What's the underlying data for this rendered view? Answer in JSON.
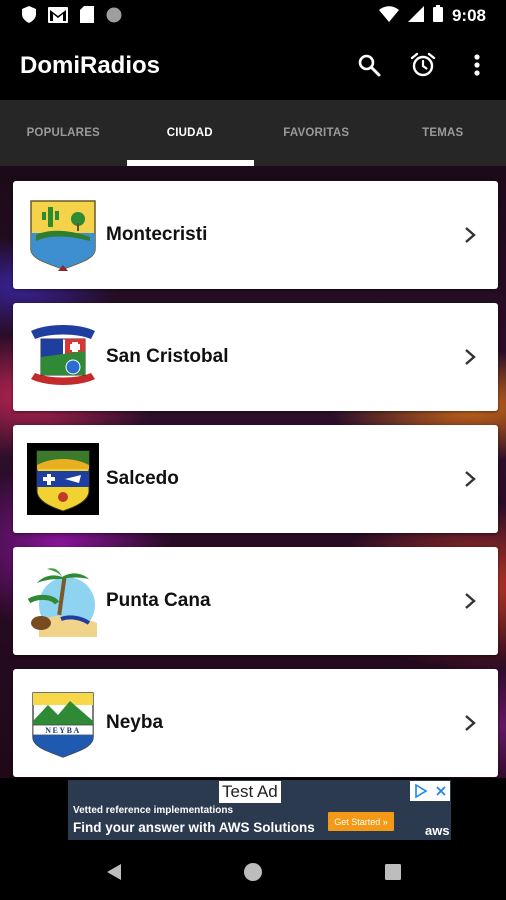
{
  "status_bar": {
    "time": "9:08",
    "left_icons": [
      "shield-icon",
      "gmail-icon",
      "sd-card-icon",
      "circle-icon"
    ],
    "right_icons": [
      "wifi-icon",
      "signal-icon",
      "battery-icon"
    ]
  },
  "app_bar": {
    "title": "DomiRadios",
    "actions": [
      "search-icon",
      "alarm-icon",
      "more-vert-icon"
    ]
  },
  "tabs": [
    {
      "label": "POPULARES",
      "active": false
    },
    {
      "label": "CIUDAD",
      "active": true
    },
    {
      "label": "FAVORITAS",
      "active": false
    },
    {
      "label": "TEMAS",
      "active": false
    }
  ],
  "cities": [
    {
      "name": "Montecristi",
      "logo": "montecristi-coat-of-arms"
    },
    {
      "name": "San Cristobal",
      "logo": "san-cristobal-coat-of-arms"
    },
    {
      "name": "Salcedo",
      "logo": "salcedo-coat-of-arms"
    },
    {
      "name": "Punta Cana",
      "logo": "punta-cana-logo"
    },
    {
      "name": "Neyba",
      "logo": "neyba-coat-of-arms",
      "logo_text": "NEYBA"
    }
  ],
  "ad": {
    "label": "Test Ad",
    "line1": "Vetted reference implementations",
    "line2": "Find your answer with AWS Solutions",
    "cta": "Get Started »",
    "brand": "aws"
  },
  "nav_bar": [
    "back-icon",
    "home-icon",
    "recents-icon"
  ],
  "colors": {
    "app_bar": "#000000",
    "tab_bar": "#262626",
    "tab_inactive": "#9a9a9a",
    "card": "#ffffff",
    "ad_cta": "#f29a16"
  }
}
